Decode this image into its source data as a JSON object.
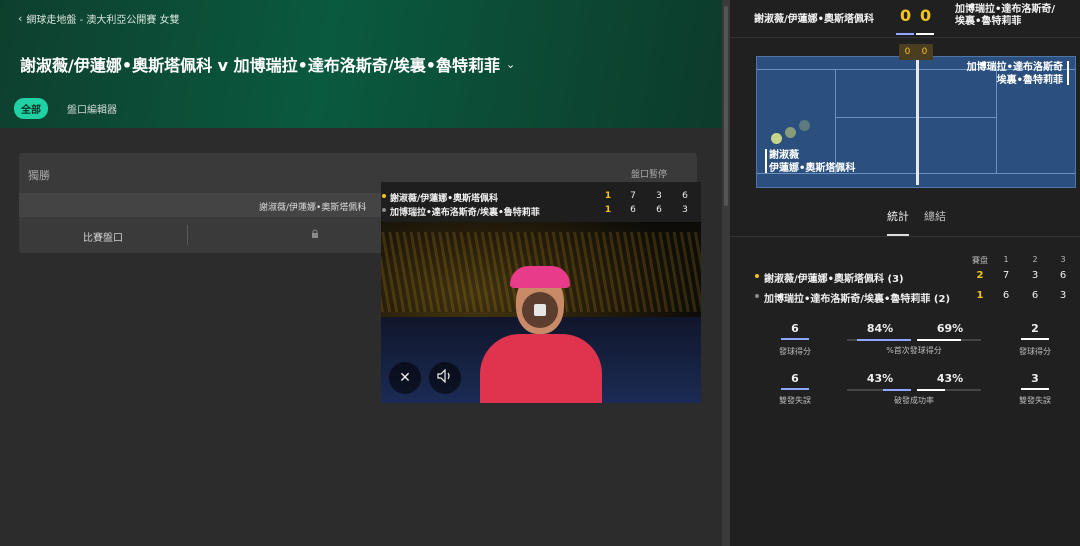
{
  "breadcrumb": "網球走地盤 - 澳大利亞公開賽 女雙",
  "match_title": "謝淑薇/伊蓮娜•奧斯塔佩科 v 加博瑞拉•達布洛斯奇/埃裏•魯特莉菲",
  "chips": {
    "all": "全部",
    "editor": "盤口編輯器"
  },
  "market": {
    "title": "獨勝",
    "status": "盤口暫停",
    "column_name": "謝淑薇/伊蓮娜•奧斯塔佩科",
    "row_label": "比賽盤口"
  },
  "video": {
    "rows": [
      {
        "name": "謝淑薇/伊蓮娜•奧斯塔佩科",
        "sets": "1",
        "s1": "7",
        "s2": "3",
        "s3": "6",
        "serving": true
      },
      {
        "name": "加博瑞拉•達布洛斯奇/埃裏•魯特莉菲",
        "sets": "1",
        "s1": "6",
        "s2": "6",
        "s3": "3",
        "serving": false
      }
    ]
  },
  "right": {
    "player1": "謝淑薇/伊蓮娜•奧斯塔佩科",
    "player2": "加博瑞拉•達布洛斯奇/埃裏•魯特莉菲",
    "game_score_1": "0",
    "game_score_2": "0",
    "court_score_1": "0",
    "court_score_2": "0",
    "court_name_1_line1": "謝淑薇",
    "court_name_1_line2": "伊蓮娜•奧斯塔佩科",
    "court_name_2_line1": "加博瑞拉•達布洛斯奇",
    "court_name_2_line2": "埃裏•魯特莉菲",
    "tabs": [
      "統計",
      "總結"
    ],
    "scoreboard": {
      "headers": [
        "賽盘",
        "1",
        "2",
        "3"
      ],
      "rows": [
        {
          "name": "謝淑薇/伊蓮娜•奧斯塔佩科 (3)",
          "sets": "2",
          "s1": "7",
          "s2": "3",
          "s3": "6"
        },
        {
          "name": "加博瑞拉•達布洛斯奇/埃裏•魯特莉菲 (2)",
          "sets": "1",
          "s1": "6",
          "s2": "6",
          "s3": "3"
        }
      ]
    },
    "stats": {
      "aces": {
        "p1": "6",
        "p2": "2",
        "label_p1": "發球得分",
        "label_p2": "發球得分"
      },
      "first_serve": {
        "p1": "84%",
        "p2": "69%",
        "label": "%首次發球得分",
        "p1_frac": 0.84,
        "p2_frac": 0.69
      },
      "double_faults": {
        "p1": "6",
        "p2": "3",
        "label_p1": "雙發失誤",
        "label_p2": "雙發失誤"
      },
      "break_points": {
        "p1": "43%",
        "p2": "43%",
        "label": "破發成功率",
        "p1_frac": 0.43,
        "p2_frac": 0.43
      }
    }
  },
  "colors": {
    "accent": "#1fd1a3",
    "gold": "#f2c41b",
    "p1": "#8fa8ff",
    "p2": "#ffffff"
  }
}
